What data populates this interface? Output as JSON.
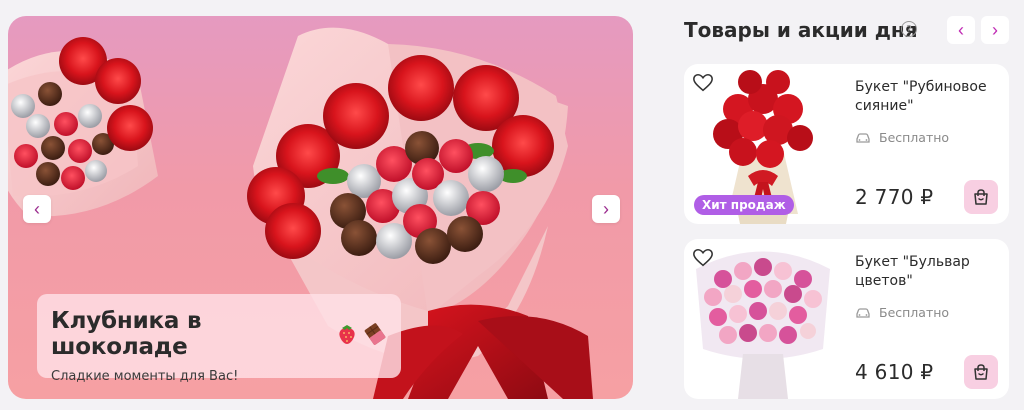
{
  "banner": {
    "title": "Клубника в шоколаде",
    "subtitle": "Сладкие моменты для Вас!",
    "prev_label": "‹",
    "next_label": "›",
    "emoji": [
      "strawberry-emoji",
      "chocolate-emoji"
    ]
  },
  "side": {
    "title": "Товары и акции дня",
    "info_label": "?",
    "prev_label": "‹",
    "next_label": "›"
  },
  "products": [
    {
      "name": "Букет \"Рубиновое сияние\"",
      "delivery": "Бесплатно",
      "price": "2 770 ₽",
      "badge": "Хит продаж",
      "image": "red-roses-bouquet"
    },
    {
      "name": "Букет \"Бульвар цветов\"",
      "delivery": "Бесплатно",
      "price": "4 610 ₽",
      "badge": "",
      "image": "pink-roses-bouquet"
    }
  ],
  "colors": {
    "accent": "#c02ab4",
    "badge": "#b05ee6",
    "cart_button": "#f8cfe2",
    "banner_gradient_top": "#e59ac0",
    "banner_gradient_bottom": "#f6a0a3"
  }
}
